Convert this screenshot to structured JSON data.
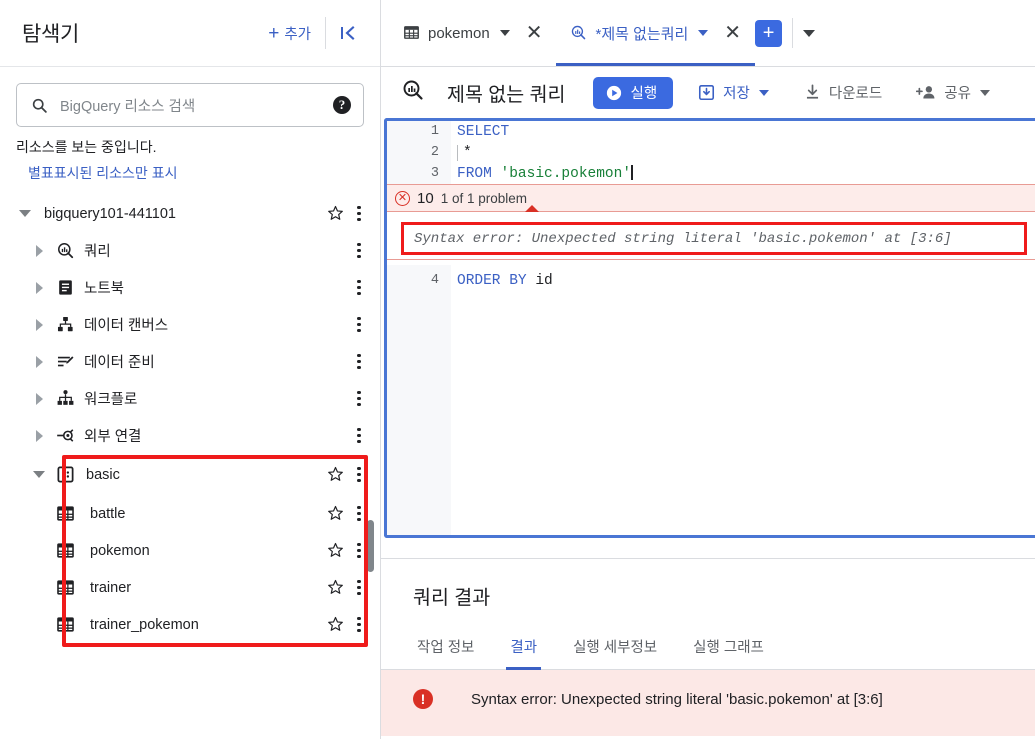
{
  "sidebar": {
    "title": "탐색기",
    "add_label": "추가",
    "collapse_icon": "collapse-panel-icon",
    "search": {
      "placeholder": "BigQuery 리소스 검색",
      "value": "",
      "help_icon": "help-icon"
    },
    "note": "리소스를 보는 중입니다.",
    "starred_link": "별표표시된 리소스만 표시",
    "project": {
      "name": "bigquery101-441101",
      "expanded": true
    },
    "project_children": [
      {
        "label": "쿼리",
        "icon": "query-icon",
        "expanded": false
      },
      {
        "label": "노트북",
        "icon": "notebook-icon",
        "expanded": false
      },
      {
        "label": "데이터 캔버스",
        "icon": "data-canvas-icon",
        "expanded": false
      },
      {
        "label": "데이터 준비",
        "icon": "data-preparation-icon",
        "expanded": false
      },
      {
        "label": "워크플로",
        "icon": "workflow-icon",
        "expanded": false
      },
      {
        "label": "외부 연결",
        "icon": "external-connection-icon",
        "expanded": false
      }
    ],
    "dataset": {
      "label": "basic",
      "icon": "dataset-icon",
      "expanded": true
    },
    "tables": [
      {
        "label": "battle",
        "icon": "table-icon"
      },
      {
        "label": "pokemon",
        "icon": "table-icon"
      },
      {
        "label": "trainer",
        "icon": "table-icon"
      },
      {
        "label": "trainer_pokemon",
        "icon": "table-icon"
      }
    ]
  },
  "tabs": [
    {
      "label": "pokemon",
      "icon": "table-icon",
      "active": false
    },
    {
      "label": "*제목 없는쿼리",
      "icon": "query-icon",
      "active": true
    }
  ],
  "tabbar": {
    "new_tab_icon": "plus-icon",
    "more_icon": "chevron-down-icon"
  },
  "toolbar": {
    "query_icon": "query-icon",
    "title": "제목 없는 쿼리",
    "run_label": "실행",
    "save_label": "저장",
    "download_label": "다운로드",
    "share_label": "공유"
  },
  "editor": {
    "lines": [
      {
        "num": "1",
        "keyword": "SELECT",
        "rest": ""
      },
      {
        "num": "2",
        "indent": true,
        "text": "*"
      },
      {
        "num": "3",
        "keyword": "FROM",
        "string": "'basic.pokemon'"
      },
      {
        "num": "4",
        "keyword": "ORDER BY",
        "plain": "id"
      }
    ],
    "problem_count": "10",
    "problem_summary": "1 of 1 problem",
    "inline_error": "Syntax error: Unexpected string literal 'basic.pokemon' at [3:6]"
  },
  "results": {
    "title": "쿼리 결과",
    "tabs": [
      {
        "label": "작업 정보",
        "active": false
      },
      {
        "label": "결과",
        "active": true
      },
      {
        "label": "실행 세부정보",
        "active": false
      },
      {
        "label": "실행 그래프",
        "active": false
      }
    ],
    "error_message": "Syntax error: Unexpected string literal 'basic.pokemon' at [3:6]"
  },
  "colors": {
    "accent_blue": "#3b60c4",
    "run_blue": "#3b6ae0",
    "error_red": "#d93025",
    "annotation_red": "#ef1b1b",
    "error_bg": "#fce8e6",
    "string_green": "#188038"
  }
}
